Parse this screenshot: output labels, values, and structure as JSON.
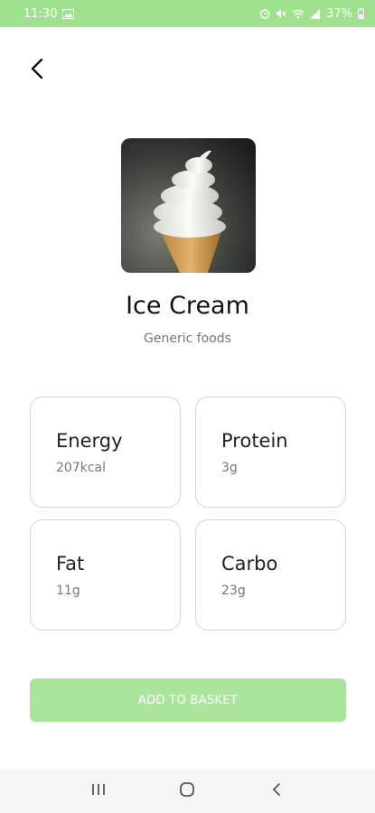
{
  "status_bar": {
    "time": "11:30",
    "battery": "37%",
    "background_color": "#9fe18e",
    "icons": [
      "image-icon",
      "alarm-icon",
      "mute-icon",
      "wifi-icon",
      "signal-icon",
      "battery-icon"
    ]
  },
  "header": {
    "back_icon": "chevron-left-icon"
  },
  "food": {
    "name": "Ice Cream",
    "category": "Generic foods",
    "image": "ice-cream-cone-photo"
  },
  "nutrients": {
    "energy": {
      "label": "Energy",
      "value": "207kcal"
    },
    "protein": {
      "label": "Protein",
      "value": "3g"
    },
    "fat": {
      "label": "Fat",
      "value": "11g"
    },
    "carbo": {
      "label": "Carbo",
      "value": "23g"
    }
  },
  "actions": {
    "add_to_basket_label": "ADD TO BASKET",
    "button_color": "#a9e59b"
  },
  "nav_bar": {
    "icons": [
      "recent-apps-icon",
      "home-icon",
      "back-nav-icon"
    ]
  }
}
